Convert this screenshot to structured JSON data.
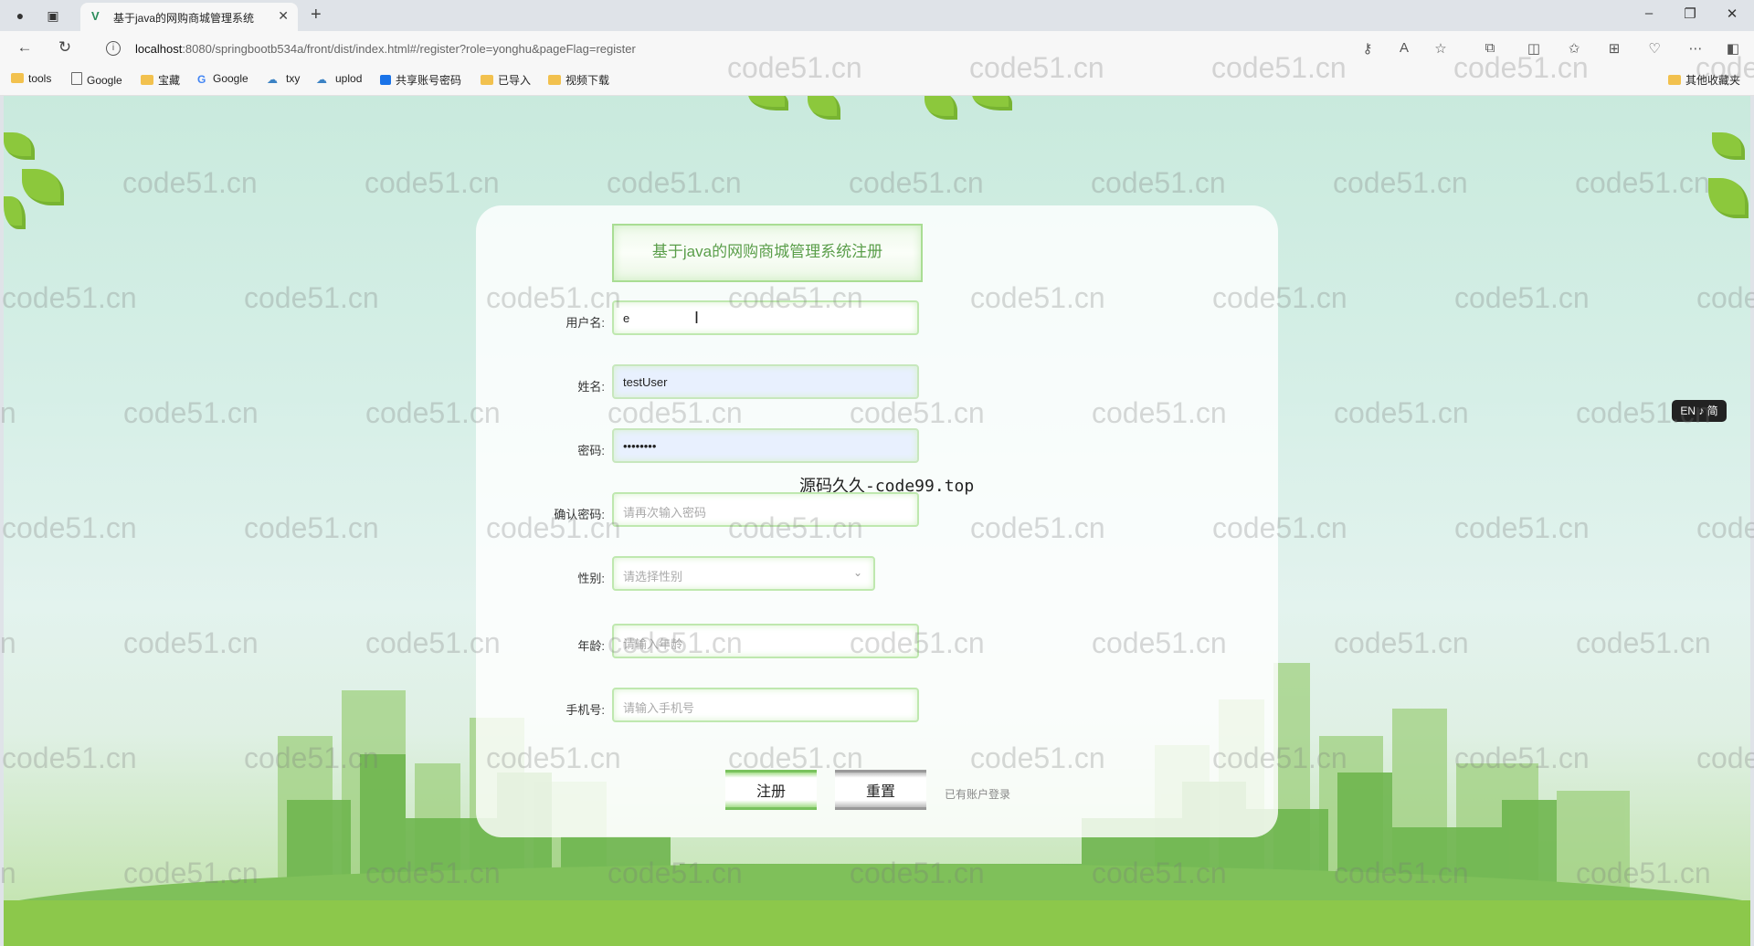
{
  "browser": {
    "tab_title": "基于java的网购商城管理系统",
    "url_host": "localhost",
    "url_rest": ":8080/springbootb534a/front/dist/index.html#/register?role=yonghu&pageFlag=register"
  },
  "bookmarks": [
    {
      "label": "tools",
      "icon": "folder-icon"
    },
    {
      "label": "Google",
      "icon": "page-icon"
    },
    {
      "label": "宝藏",
      "icon": "folder-icon"
    },
    {
      "label": "Google",
      "icon": "google-icon"
    },
    {
      "label": "txy",
      "icon": "cloud-icon"
    },
    {
      "label": "uplod",
      "icon": "cloud-icon"
    },
    {
      "label": "共享账号密码",
      "icon": "share-icon"
    },
    {
      "label": "已导入",
      "icon": "folder-icon"
    },
    {
      "label": "视频下载",
      "icon": "folder-icon"
    }
  ],
  "other_bookmarks": "其他收藏夹",
  "watermark": "code51.cn",
  "lang_badge": "EN ♪ 简",
  "form": {
    "title": "基于java的网购商城管理系统注册",
    "username": {
      "label": "用户名:",
      "value": "e"
    },
    "name": {
      "label": "姓名:",
      "value": "testUser"
    },
    "password": {
      "label": "密码:",
      "value": "••••••••"
    },
    "confirm_password": {
      "label": "确认密码:",
      "placeholder": "请再次输入密码"
    },
    "gender": {
      "label": "性别:",
      "placeholder": "请选择性别"
    },
    "age": {
      "label": "年龄:",
      "placeholder": "请输入年龄"
    },
    "phone": {
      "label": "手机号:",
      "placeholder": "请输入手机号"
    },
    "register_button": "注册",
    "reset_button": "重置",
    "login_link": "已有账户登录"
  },
  "notice": "源码久久-code99.top"
}
